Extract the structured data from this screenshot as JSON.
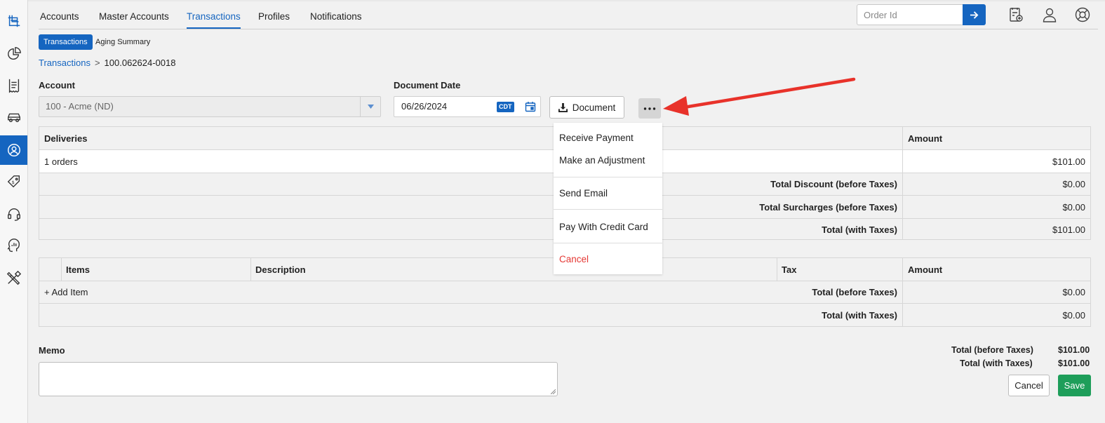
{
  "nav": {
    "tabs": [
      {
        "label": "Accounts"
      },
      {
        "label": "Master Accounts"
      },
      {
        "label": "Transactions"
      },
      {
        "label": "Profiles"
      },
      {
        "label": "Notifications"
      }
    ],
    "active_tab": "Transactions",
    "order_placeholder": "Order Id"
  },
  "subtabs": {
    "active": "Transactions",
    "other": "Aging Summary"
  },
  "breadcrumb": {
    "link": "Transactions",
    "separator": ">",
    "current": "100.062624-0018"
  },
  "form": {
    "account_label": "Account",
    "account_value": "100 - Acme (ND)",
    "date_label": "Document Date",
    "date_value": "06/26/2024",
    "timezone": "CDT",
    "document_button": "Document"
  },
  "menu": {
    "items": [
      "Receive Payment",
      "Make an Adjustment",
      "Send Email",
      "Pay With Credit Card",
      "Cancel"
    ]
  },
  "deliveries_table": {
    "headers": {
      "deliveries": "Deliveries",
      "amount": "Amount"
    },
    "row": {
      "label": "1 orders",
      "amount": "$101.00"
    },
    "summary": [
      {
        "label": "Total Discount (before Taxes)",
        "value": "$0.00"
      },
      {
        "label": "Total Surcharges (before Taxes)",
        "value": "$0.00"
      },
      {
        "label": "Total (with Taxes)",
        "value": "$101.00"
      }
    ]
  },
  "items_table": {
    "headers": {
      "items": "Items",
      "description": "Description",
      "tax": "Tax",
      "amount": "Amount"
    },
    "add_item": "+ Add Item",
    "summary": [
      {
        "label": "Total (before Taxes)",
        "value": "$0.00"
      },
      {
        "label": "Total (with Taxes)",
        "value": "$0.00"
      }
    ]
  },
  "memo": {
    "label": "Memo",
    "value": ""
  },
  "totals": [
    {
      "label": "Total (before Taxes)",
      "value": "$101.00"
    },
    {
      "label": "Total (with Taxes)",
      "value": "$101.00"
    }
  ],
  "actions": {
    "cancel": "Cancel",
    "save": "Save"
  },
  "colors": {
    "primary": "#1565c0",
    "save": "#1e9e5a",
    "danger": "#e53935",
    "annotation_arrow": "#e8322a"
  }
}
